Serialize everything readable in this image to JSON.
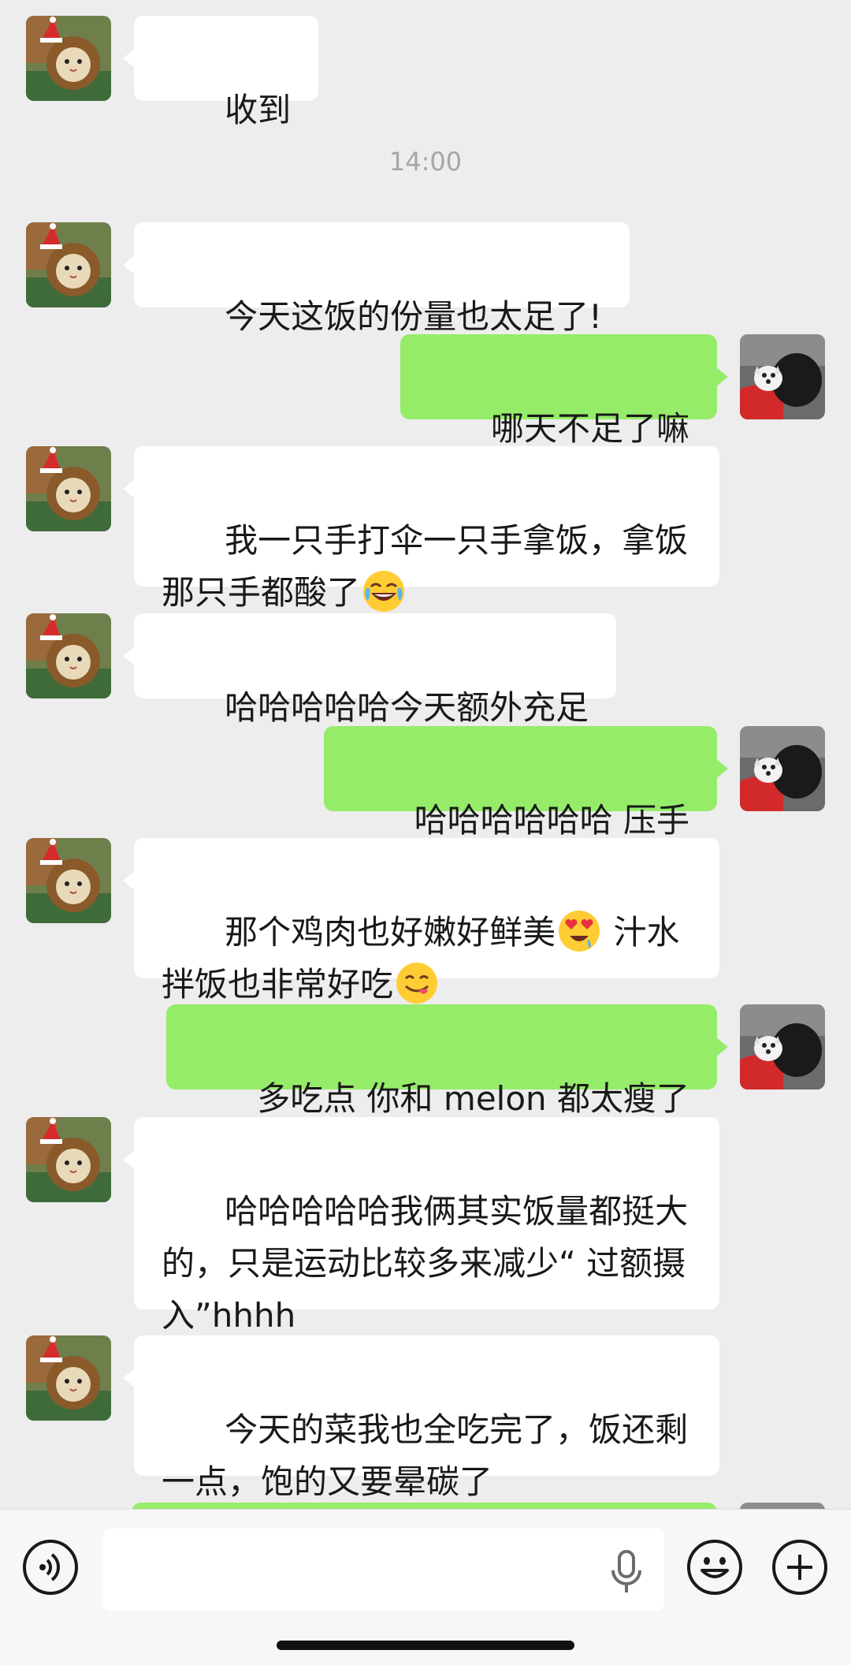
{
  "app": {
    "accent_sent": "#95ec69",
    "received_bg": "#ffffff",
    "chat_bg": "#ededed"
  },
  "avatars": {
    "contact": "cat-with-lion-mane-avatar",
    "self": "white-dog-with-black-dog-avatar"
  },
  "timestamp": "14:00",
  "messages": [
    {
      "side": "left",
      "text": "收到"
    },
    {
      "side": "left",
      "text": "今天这饭的份量也太足了!"
    },
    {
      "side": "right",
      "text": "哪天不足了嘛"
    },
    {
      "side": "left",
      "text": "我一只手打伞一只手拿饭，拿饭那只手都酸了"
    },
    {
      "side": "left",
      "text": "哈哈哈哈哈今天额外充足"
    },
    {
      "side": "right",
      "text": "哈哈哈哈哈哈 压手"
    },
    {
      "side": "left",
      "text_a": "那个鸡肉也好嫩好鲜美",
      "text_b": " 汁水拌饭也非常好吃"
    },
    {
      "side": "right",
      "text": "多吃点 你和 melon 都太瘦了"
    },
    {
      "side": "left",
      "text": "哈哈哈哈哈我俩其实饭量都挺大的，只是运动比较多来减少“ 过额摄入”hhhh"
    },
    {
      "side": "left",
      "text": "今天的菜我也全吃完了，饭还剩一点，饱的又要晕碳了"
    }
  ],
  "emojis": {
    "tears_of_joy": "face-with-tears-of-joy-icon",
    "heart_eyes": "smiling-face-with-heart-eyes-icon",
    "yum": "face-savoring-food-icon"
  },
  "input_bar": {
    "voice_icon": "voice-mode-icon",
    "mic_icon": "microphone-icon",
    "emoji_icon": "emoji-picker-icon",
    "plus_icon": "more-plus-icon",
    "value": ""
  }
}
